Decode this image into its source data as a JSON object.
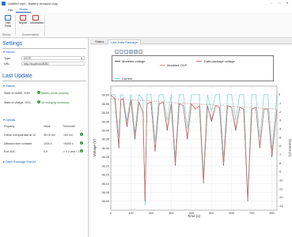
{
  "window": {
    "title": "Untitled.mph - Battery Analyzer App",
    "minimize": "–",
    "maximize": "□",
    "close": "✕"
  },
  "menu": {
    "tabs": [
      "File",
      "Home"
    ],
    "active": 1
  },
  "ribbon": {
    "buttons": [
      {
        "label": "Live Feed",
        "icon": "monitor-icon"
      },
      {
        "label": "Report",
        "icon": "report-icon"
      },
      {
        "label": "Information",
        "icon": "info-icon"
      }
    ],
    "groups": [
      "Monitor",
      "Documentation"
    ]
  },
  "settings": {
    "title": "Settings",
    "server": {
      "heading": "Server",
      "type_label": "Type:",
      "type_value": "HTTP",
      "url_label": "URL:",
      "url_value": "http://localhost:8080"
    }
  },
  "last_update": {
    "title": "Last Update",
    "status": {
      "heading": "Status",
      "soh_label": "State of health, SOH",
      "soh_text": "Battery works properly",
      "soc_label": "State of charge, SOC",
      "soc_text": "No charging necessary"
    },
    "details": {
      "heading": "Details",
      "columns": [
        "Property",
        "Value",
        "Threshold"
      ],
      "rows": [
        {
          "property": "Ohmic overpotential at 1C",
          "value": "36.19 mV",
          "threshold": "<50 mV"
        },
        {
          "property": "Diffusion time constant",
          "value": "1000 s",
          "threshold": "<5000 s"
        },
        {
          "property": "End SOC",
          "value": "0.9",
          "threshold": "> 0.2 and < 1"
        }
      ]
    },
    "export_heading": "Data Package Export"
  },
  "main_tabs": [
    "Status",
    "Last Data Package"
  ],
  "active_main_tab": 1,
  "chart_data": {
    "type": "line",
    "title": "",
    "xlabel": "Time (s)",
    "ylabel": "Voltage (V)",
    "y2label": "Current (A)",
    "xlim": [
      0,
      825
    ],
    "ylim": [
      35.95,
      36.65
    ],
    "y2lim": [
      -13.5,
      1
    ],
    "xticks": [
      0,
      100,
      200,
      300,
      400,
      500,
      600,
      700,
      800
    ],
    "yticks": [
      36.0,
      36.05,
      36.1,
      36.15,
      36.2,
      36.25,
      36.3,
      36.35,
      36.4,
      36.45,
      36.5,
      36.55,
      36.6
    ],
    "y2ticks": [
      0,
      -1,
      -2,
      -3,
      -4,
      -5,
      -6,
      -7,
      -8,
      -9,
      -10,
      -11,
      -12,
      -13
    ],
    "grid": true,
    "legend_position": "top",
    "series": [
      {
        "name": "Modeled voltage",
        "color": "#555555",
        "axis": "left",
        "x": [
          0,
          20,
          40,
          50,
          60,
          80,
          100,
          120,
          140,
          160,
          170,
          180,
          200,
          220,
          240,
          260,
          280,
          300,
          320,
          340,
          360,
          380,
          400,
          420,
          440,
          460,
          480,
          500,
          520,
          540,
          560,
          580,
          600,
          620,
          640,
          660,
          680,
          700,
          720,
          740,
          760,
          780,
          800,
          825
        ],
        "y": [
          36.6,
          36.58,
          36.3,
          36.57,
          36.58,
          36.42,
          36.57,
          36.35,
          36.56,
          36.5,
          36.0,
          36.55,
          36.56,
          36.28,
          36.55,
          36.56,
          36.4,
          36.55,
          36.2,
          36.55,
          36.54,
          36.35,
          36.55,
          36.52,
          36.54,
          36.1,
          36.54,
          36.45,
          36.54,
          36.53,
          36.2,
          36.54,
          36.53,
          36.4,
          36.53,
          36.52,
          36.0,
          36.52,
          36.53,
          36.3,
          36.52,
          36.52,
          36.25,
          36.52
        ]
      },
      {
        "name": "Modeled OCP",
        "color": "#d98c8c",
        "axis": "left",
        "x": [
          0,
          825
        ],
        "y": [
          36.58,
          36.52
        ]
      },
      {
        "name": "Data package voltage",
        "color": "#e07070",
        "axis": "left",
        "x": [
          0,
          20,
          40,
          50,
          60,
          80,
          100,
          120,
          140,
          160,
          170,
          180,
          200,
          220,
          240,
          260,
          280,
          300,
          320,
          340,
          360,
          380,
          400,
          420,
          440,
          460,
          480,
          500,
          520,
          540,
          560,
          580,
          600,
          620,
          640,
          660,
          680,
          700,
          720,
          740,
          760,
          780,
          800,
          825
        ],
        "y": [
          36.6,
          36.58,
          36.31,
          36.57,
          36.58,
          36.43,
          36.57,
          36.36,
          36.56,
          36.5,
          36.01,
          36.55,
          36.56,
          36.29,
          36.55,
          36.56,
          36.41,
          36.55,
          36.21,
          36.55,
          36.54,
          36.36,
          36.55,
          36.52,
          36.54,
          36.11,
          36.54,
          36.46,
          36.54,
          36.53,
          36.21,
          36.54,
          36.53,
          36.41,
          36.53,
          36.52,
          36.01,
          36.52,
          36.53,
          36.31,
          36.52,
          36.52,
          36.26,
          36.52
        ]
      },
      {
        "name": "Current",
        "color": "#6fd6d6",
        "axis": "right",
        "x": [
          0,
          20,
          40,
          50,
          60,
          80,
          100,
          120,
          140,
          160,
          170,
          180,
          200,
          220,
          240,
          260,
          280,
          300,
          320,
          340,
          360,
          380,
          400,
          420,
          440,
          460,
          480,
          500,
          520,
          540,
          560,
          580,
          600,
          620,
          640,
          660,
          680,
          700,
          720,
          740,
          760,
          780,
          800,
          825
        ],
        "y": [
          0,
          0,
          -5,
          0,
          0,
          -3,
          0,
          -4.5,
          0,
          -0.5,
          -13,
          0,
          0,
          -5.5,
          0,
          0,
          -3,
          0,
          -7.5,
          0,
          0,
          -4,
          0,
          0,
          0,
          -9.5,
          0,
          -2,
          0,
          0,
          -7.5,
          0,
          0,
          -3,
          0,
          0,
          -12,
          0,
          0,
          -5,
          0,
          0,
          -6.5,
          0
        ]
      }
    ]
  }
}
